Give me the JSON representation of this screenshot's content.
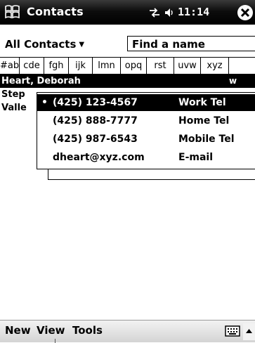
{
  "titlebar": {
    "title": "Contacts",
    "time": "11:14",
    "icons": [
      "windows-start-icon",
      "connectivity-icon",
      "volume-icon",
      "close-icon"
    ]
  },
  "filter": {
    "category_label": "All Contacts",
    "category_caret": "▼",
    "find_placeholder": "Find a name"
  },
  "tabs": [
    "#ab",
    "cde",
    "fgh",
    "ijk",
    "lmn",
    "opq",
    "rst",
    "uvw",
    "xyz"
  ],
  "contacts": [
    {
      "name": "Heart, Deborah",
      "letter": "w",
      "selected": true
    },
    {
      "name": "Step",
      "letter": "",
      "selected": false
    },
    {
      "name": "Valle",
      "letter": "",
      "selected": false
    }
  ],
  "popup": {
    "items": [
      {
        "bullet": "•",
        "value": "(425) 123-4567",
        "kind": "Work Tel",
        "active": true
      },
      {
        "bullet": "",
        "value": "(425) 888-7777",
        "kind": "Home Tel",
        "active": false
      },
      {
        "bullet": "",
        "value": "(425) 987-6543",
        "kind": "Mobile Tel",
        "active": false
      },
      {
        "bullet": "",
        "value": "dheart@xyz.com",
        "kind": "E-mail",
        "active": false
      }
    ]
  },
  "menubar": {
    "items": [
      "New",
      "View",
      "Tools"
    ]
  },
  "colors": {
    "titlebar_bg": "#000000",
    "selection_bg": "#000000",
    "selection_fg": "#ffffff",
    "menubar_bg": "#dddddd"
  }
}
